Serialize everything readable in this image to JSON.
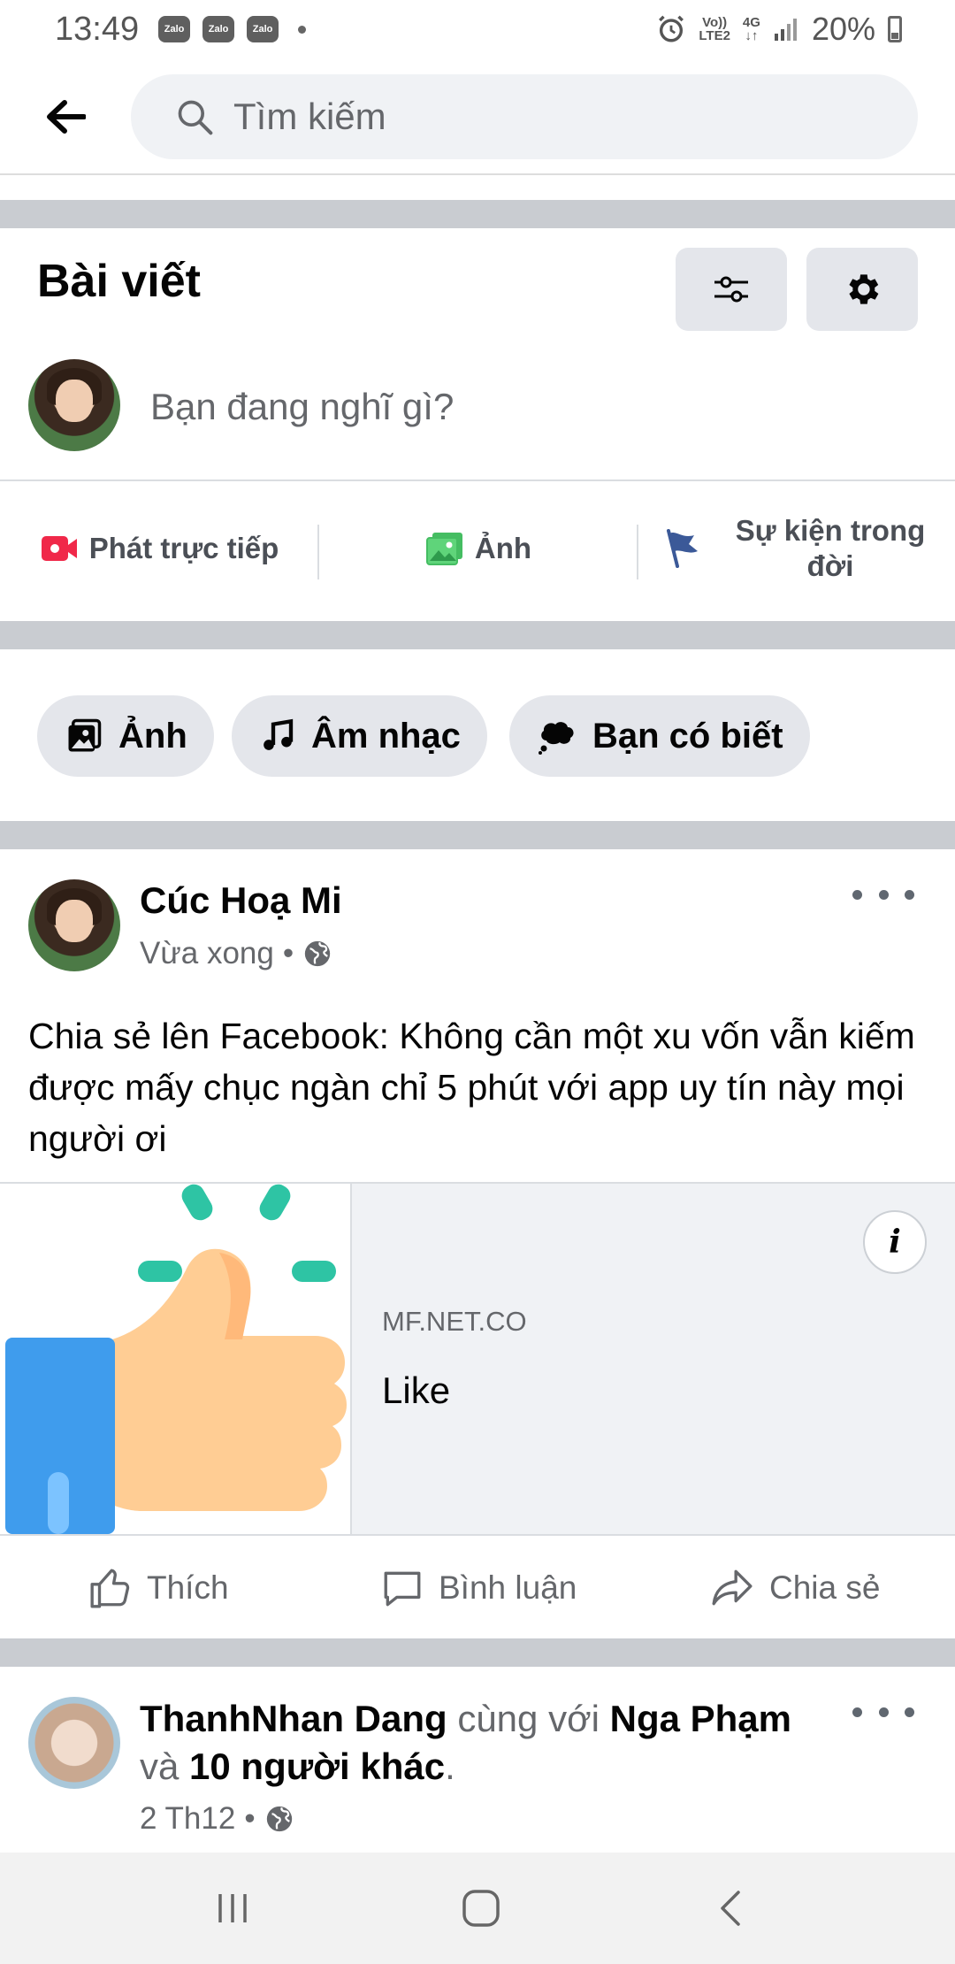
{
  "status_bar": {
    "time": "13:49",
    "notifications": [
      "Zalo",
      "Zalo",
      "Zalo"
    ],
    "network_top": "Vo))",
    "network_bottom": "LTE2",
    "network_type": "4G",
    "battery": "20%"
  },
  "search": {
    "placeholder": "Tìm kiếm"
  },
  "posts_section": {
    "title": "Bài viết"
  },
  "composer": {
    "placeholder": "Bạn đang nghĩ gì?",
    "actions": [
      "Phát trực tiếp",
      "Ảnh",
      "Sự kiện trong đời"
    ]
  },
  "chips": [
    "Ảnh",
    "Âm nhạc",
    "Bạn có biết"
  ],
  "post1": {
    "author": "Cúc Hoạ Mi",
    "time": "Vừa xong",
    "separator": "•",
    "text": "Chia sẻ lên Facebook: Không cần một xu vốn vẫn kiếm được mấy chục ngàn chỉ 5 phút với app uy tín này mọi người ơi",
    "link": {
      "domain": "MF.NET.CO",
      "title": "Like",
      "info": "i"
    },
    "actions": [
      "Thích",
      "Bình luận",
      "Chia sẻ"
    ]
  },
  "post2": {
    "author": "ThanhNhan Dang",
    "with_text": "cùng với",
    "tagged": "Nga Phạm",
    "and_text": "và",
    "others": "10 người khác",
    "period": ".",
    "time": "2 Th12",
    "separator": "•"
  },
  "colors": {
    "accent": "#1877f2",
    "live": "#f02849",
    "photo": "#45bd62",
    "flag": "#3b5998"
  }
}
